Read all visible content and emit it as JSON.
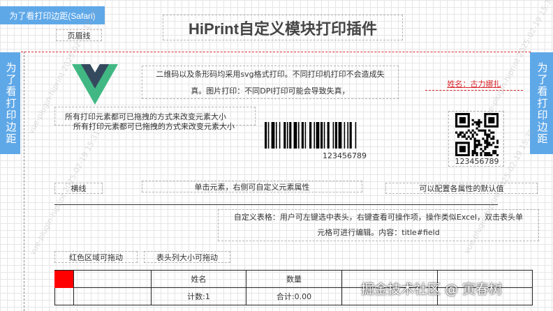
{
  "tabs": {
    "top_left": "为了看打印边距(Safari)",
    "left": "为了看打印边距",
    "right": "为了看打印边距"
  },
  "header": {
    "page_header_line": "页眉线",
    "title": "HiPrint自定义模块打印插件"
  },
  "content": {
    "svg_note_line1": "二维码以及条形码均采用svg格式打印。不同打印机打印不会造成失",
    "svg_note_line2": "真。图片打印：不同DPI打印可能会导致失真，",
    "name_field": "姓名：古力娜扎",
    "drag_note_1": "所有打印元素都可已拖拽的方式来改变元素大小",
    "drag_note_2": "所有打印元素都可已拖拽的方式来改变元素大小",
    "barcode_number": "123456789",
    "qrcode_number": "123456789",
    "horizontal_line": "横线",
    "click_element": "单击元素，右侧可自定义元素属性",
    "default_values": "可以配置各属性的默认值",
    "custom_table_line1": "自定义表格：用户可左键选中表头，右键查看可操作项，操作类似Excel，双击表头单",
    "custom_table_line2": "元格可进行编辑。内容：title#field",
    "red_area": "红色区域可拖动",
    "header_resize": "表头列大小可拖动"
  },
  "table": {
    "headers": [
      "",
      "",
      "姓名",
      "数量",
      "",
      ""
    ],
    "row1": [
      "",
      "",
      "计数:1",
      "合计:0.00",
      "",
      ""
    ]
  },
  "watermark": {
    "text": "vue-plugin-hiprint 2025-02-19 15:31"
  },
  "footer_watermark": "掘金技术社区 @ 寅春树",
  "colors": {
    "tab_blue": "#5fa8e8",
    "name_red": "#d9262c",
    "handle_red": "#ff0000",
    "vue_green": "#41b883",
    "vue_dark": "#34495e"
  }
}
